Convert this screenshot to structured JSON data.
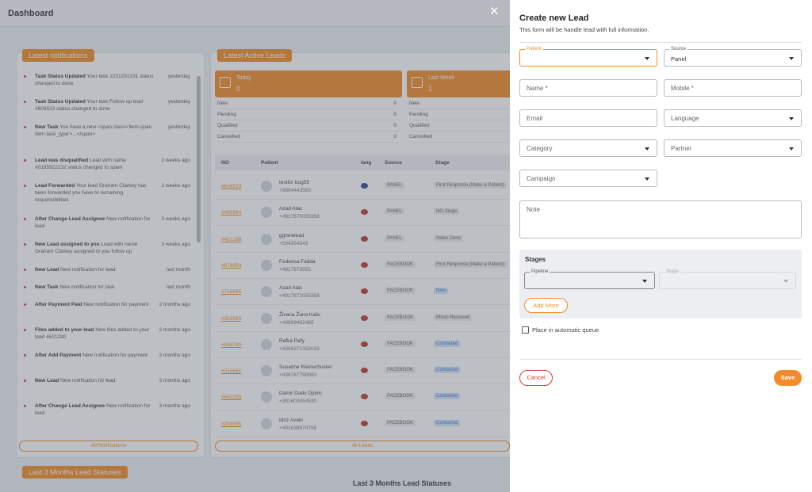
{
  "dashboard": {
    "title": "Dashboard",
    "notifications_label": "Latest notifications",
    "active_leads_label": "Latest Active Leads",
    "all_notifications": "All Notifications",
    "all_leads": "All Leads",
    "last3_label": "Last 3 Months Lead Statuses",
    "last3_title": "Last 3 Months Lead Statuses",
    "notifications": [
      {
        "title": "Task Status Updated",
        "text": "Your task 1231231231 status changed to done",
        "time": "yesterday"
      },
      {
        "title": "Task Status Updated",
        "text": "Your task Follow up lead #608523 status changed to done",
        "time": "yesterday"
      },
      {
        "title": "New Task",
        "text": "You have a new <span class='item-span item-task_type'>...</span>",
        "time": "yesterday"
      },
      {
        "title": "Lead was disqualified",
        "text": "Lead with name #0185922232 status changed to spam",
        "time": "2 weeks ago"
      },
      {
        "title": "Lead Forwarded",
        "text": "Your lead Graham Clarkey has been forwarded you have to remaining responsibilities",
        "time": "2 weeks ago"
      },
      {
        "title": "After Change Lead Assignee",
        "text": "New notification for lead",
        "time": "3 weeks ago"
      },
      {
        "title": "New Lead assigned to you",
        "text": "Lead with name Graham Clarkey assigned to you follow up",
        "time": "3 weeks ago"
      },
      {
        "title": "New Lead",
        "text": "New notification for lead",
        "time": "last month"
      },
      {
        "title": "New Task",
        "text": "New notification for task",
        "time": "last month"
      },
      {
        "title": "After Payment Paid",
        "text": "New notification for payment",
        "time": "2 months ago"
      },
      {
        "title": "Files added to your lead",
        "text": "New files added to your lead #621290",
        "time": "2 months ago"
      },
      {
        "title": "After Add Payment",
        "text": "New notification for payment",
        "time": "2 months ago"
      },
      {
        "title": "New Lead",
        "text": "New notification for lead",
        "time": "3 months ago"
      },
      {
        "title": "After Change Lead Assignee",
        "text": "New notification for lead",
        "time": "3 months ago"
      }
    ],
    "stat_cards": [
      {
        "label": "Today",
        "value": "0",
        "rows": [
          [
            "New",
            "0"
          ],
          [
            "Pending",
            "0"
          ],
          [
            "Qualified",
            "0"
          ],
          [
            "Cancelled",
            "0"
          ]
        ]
      },
      {
        "label": "Last Week",
        "value": "1",
        "rows": [
          [
            "New",
            ""
          ],
          [
            "Pending",
            ""
          ],
          [
            "Qualified",
            ""
          ],
          [
            "Cancelled",
            ""
          ]
        ]
      }
    ],
    "lead_headers": {
      "no": "NO",
      "patient": "Patient",
      "lang": "lang",
      "source": "Source",
      "stage": "Stage"
    },
    "leads": [
      {
        "no": "#608523",
        "name": "testfor bug55",
        "phone": "+9864443563",
        "source": "PANEL",
        "stage": "First Response (Make a Patient)",
        "blue": false
      },
      {
        "no": "#485594",
        "name": "Azad Atac",
        "phone": "+4917673055358",
        "source": "PANEL",
        "stage": "NO Stage",
        "blue": false
      },
      {
        "no": "#421298",
        "name": "ggnewlead",
        "phone": "+534354343",
        "source": "PANEL",
        "stage": "Sales Done",
        "blue": false
      },
      {
        "no": "#876954",
        "name": "Federica Fadda",
        "phone": "+4917673055",
        "source": "FACEBOOK",
        "stage": "First Response (Make a Patient)",
        "blue": false
      },
      {
        "no": "#716895",
        "name": "Azad Atac",
        "phone": "+4917673055358",
        "source": "FACEBOOK",
        "stage": "New",
        "blue": true
      },
      {
        "no": "#563560",
        "name": "Živana Žana Kalic",
        "phone": "+43699462465",
        "source": "FACEBOOK",
        "stage": "Photo Received",
        "blue": false
      },
      {
        "no": "#938740",
        "name": "Refka Refy",
        "phone": "+4366371358033",
        "source": "FACEBOOK",
        "stage": "Contacted",
        "blue": true
      },
      {
        "no": "#316681",
        "name": "Susanne Kleinschuster",
        "phone": "+436767758983",
        "source": "FACEBOOK",
        "stage": "Contacted",
        "blue": true
      },
      {
        "no": "#682293",
        "name": "Damir Dado Djokic",
        "phone": "+381603454530",
        "source": "FACEBOOK",
        "stage": "Contacted",
        "blue": true
      },
      {
        "no": "#208065",
        "name": "Idriz Avani",
        "phone": "+491638674788",
        "source": "FACEBOOK",
        "stage": "Contacted",
        "blue": true
      }
    ]
  },
  "form": {
    "title": "Create new Lead",
    "subtitle": "This form will be handle lead with full information.",
    "patient_legend": "Patient",
    "source_legend": "Source",
    "source_value": "Panel",
    "name_placeholder": "Name *",
    "mobile_placeholder": "Mobile *",
    "email_placeholder": "Email",
    "language_placeholder": "Language",
    "category_placeholder": "Category",
    "partner_placeholder": "Partner",
    "campaign_placeholder": "Campaign",
    "note_placeholder": "Note",
    "stages_title": "Stages",
    "pipeline_legend": "Pipeline",
    "stage_legend": "Stage",
    "add_more": "Add More",
    "queue_label": "Place in automatic queue",
    "cancel": "Cancel",
    "save": "Save"
  },
  "colors": {
    "accent": "#f28c28",
    "danger": "#e53935"
  }
}
